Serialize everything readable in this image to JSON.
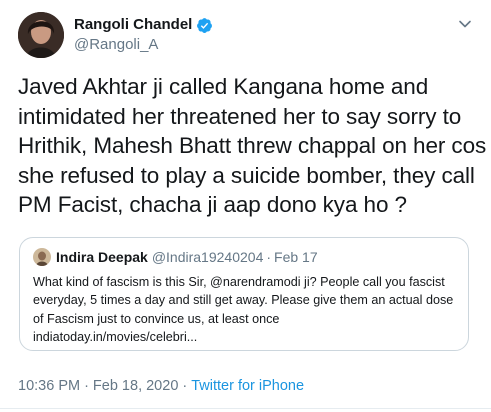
{
  "author": {
    "display_name": "Rangoli Chandel",
    "handle": "@Rangoli_A",
    "verified": true
  },
  "tweet": {
    "text": "Javed Akhtar ji called Kangana home and intimidated her threatened her to say sorry to Hrithik, Mahesh Bhatt threw chappal on her cos she refused to play a suicide bomber, they call PM Facist, chacha ji aap dono kya ho ?"
  },
  "quoted_tweet": {
    "display_name": "Indira Deepak",
    "handle": "@Indira19240204",
    "separator": "·",
    "date": "Feb 17",
    "text": "What kind of fascism is this Sir, @narendramodi ji? People call you fascist everyday, 5 times a day and still get away. Please give them an actual dose of Fascism just to convince us, at least once",
    "link": "indiatoday.in/movies/celebri..."
  },
  "footer": {
    "time": "10:36 PM",
    "separator": "·",
    "date": "Feb 18, 2020",
    "separator2": "·",
    "source": "Twitter for iPhone"
  },
  "icons": {
    "verified": "verified-badge-icon",
    "menu": "chevron-down-icon"
  },
  "colors": {
    "verified": "#1da1f2",
    "source_link": "#1b95e0",
    "muted": "#657786",
    "border": "#ccd6dd"
  }
}
